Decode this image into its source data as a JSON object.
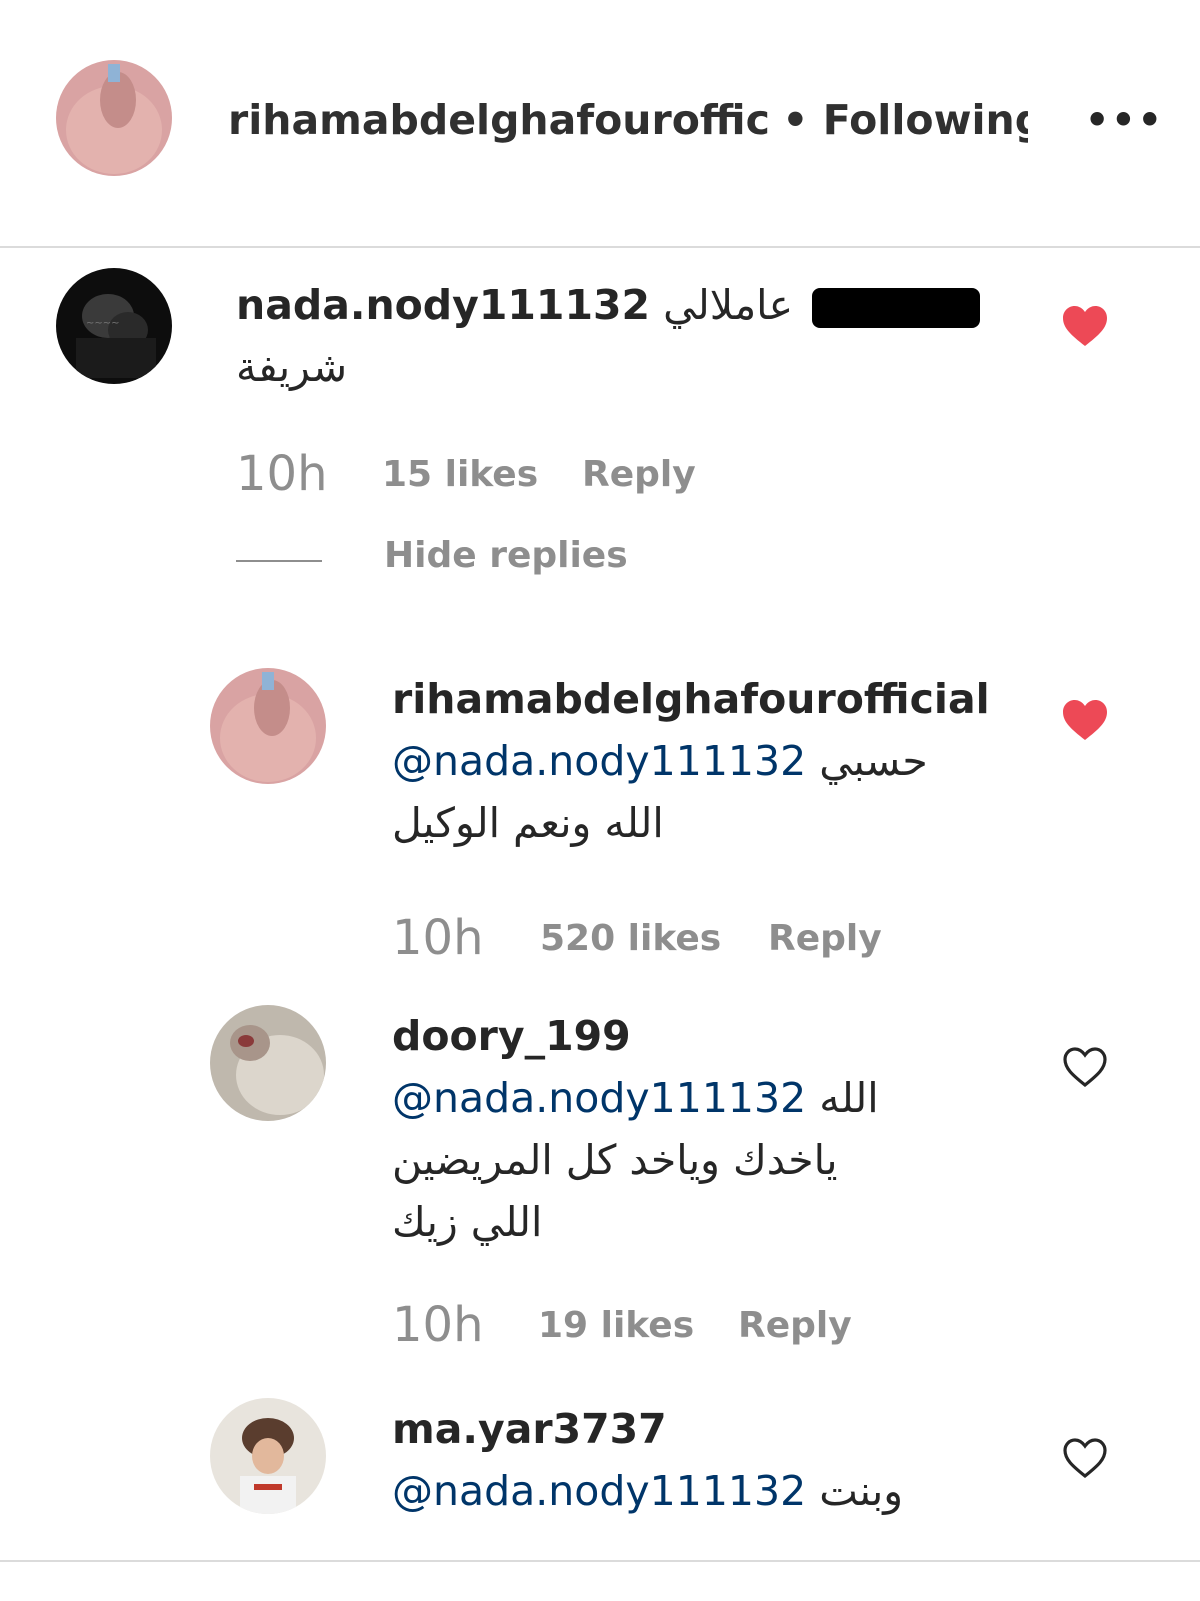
{
  "header": {
    "username": "rihamabdelghafourofficial",
    "separator": "•",
    "follow_status": "Following",
    "more_label": "•••"
  },
  "comments": [
    {
      "username": "nada.nody111132",
      "text_line1": "عاملالي",
      "text_line2": "شريفة",
      "time": "10h",
      "likes": "15 likes",
      "reply": "Reply",
      "liked": true
    }
  ],
  "hide_replies": "Hide replies",
  "replies": [
    {
      "username": "rihamabdelghafourofficial",
      "mention": "@nada.nody111132",
      "text_line1": "حسبي",
      "text_line2": "الله ونعم الوكيل",
      "time": "10h",
      "likes": "520 likes",
      "reply": "Reply",
      "liked": true
    },
    {
      "username": "doory_199",
      "mention": "@nada.nody111132",
      "text_line1": "الله",
      "text_line2": "ياخدك وياخد كل المريضين",
      "text_line3": "اللي زيك",
      "time": "10h",
      "likes": "19 likes",
      "reply": "Reply",
      "liked": false
    },
    {
      "username": "ma.yar3737",
      "mention": "@nada.nody111132",
      "text_line1": "وبنت",
      "liked": false
    }
  ],
  "colors": {
    "heart_liked": "#ed4956",
    "meta_text": "#8e8e8e",
    "mention": "#003569",
    "divider": "#dbdbdb"
  }
}
